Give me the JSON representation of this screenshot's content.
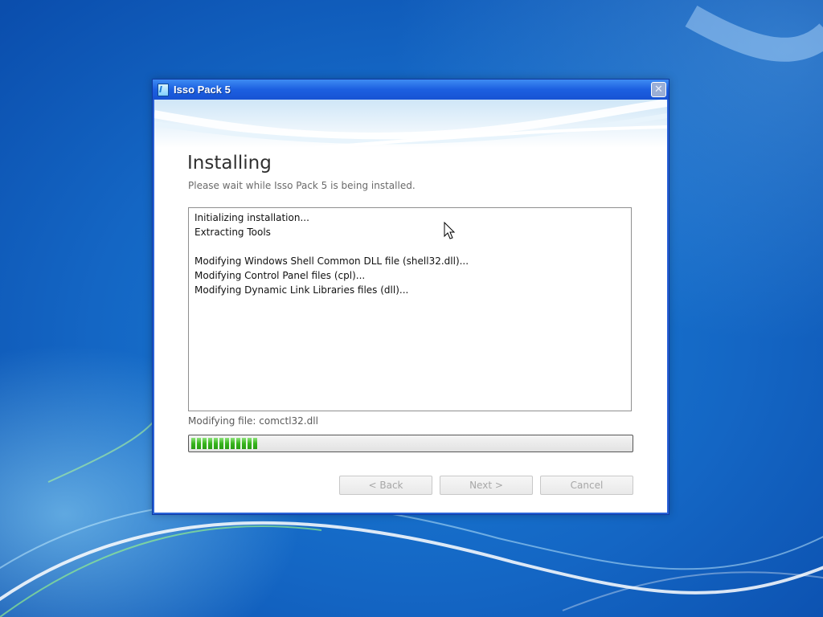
{
  "window": {
    "title": "Isso Pack 5",
    "close_glyph": "✕",
    "icon": "installer-app-icon"
  },
  "page": {
    "heading": "Installing",
    "subheading": "Please wait while Isso Pack 5 is being installed."
  },
  "log": {
    "lines": [
      "Initializing installation...",
      "Extracting Tools",
      "",
      "Modifying Windows Shell Common DLL file (shell32.dll)...",
      "Modifying Control Panel files (cpl)...",
      "Modifying Dynamic Link Libraries files (dll)..."
    ]
  },
  "status": {
    "current_file": "Modifying file: comctl32.dll"
  },
  "progress": {
    "fraction": 0.15,
    "fill_color": "#37b41d"
  },
  "buttons": {
    "back": "< Back",
    "next": "Next >",
    "cancel": "Cancel"
  },
  "colors": {
    "titlebar": "#2a63d8",
    "desktop": "#1466c4"
  }
}
